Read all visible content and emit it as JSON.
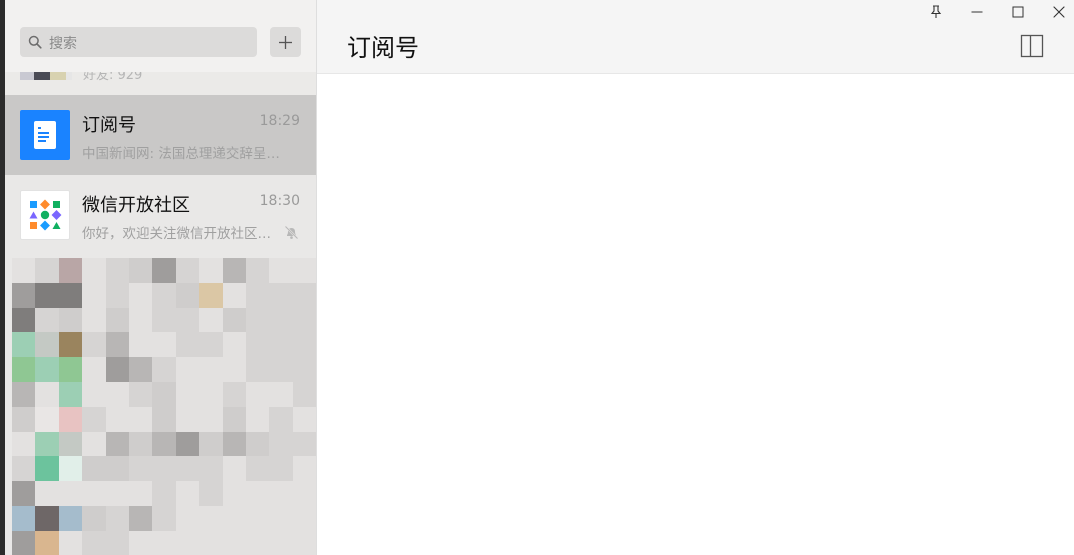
{
  "sidebar": {
    "search": {
      "placeholder": "搜索"
    },
    "partial_item": {
      "preview_fragment": "好友: 929"
    },
    "chats": [
      {
        "name": "订阅号",
        "time": "18:29",
        "preview": "中国新闻网: 法国总理递交辞呈…",
        "avatar": "subscription-icon",
        "active": true,
        "muted": false
      },
      {
        "name": "微信开放社区",
        "time": "18:30",
        "preview": "你好，欢迎关注微信开放社区…",
        "avatar": "open-community-logo",
        "active": false,
        "muted": true
      }
    ],
    "redacted_area": "pixelated-content"
  },
  "main": {
    "title": "订阅号"
  },
  "window_controls": [
    "pin-icon",
    "minimize-icon",
    "maximize-icon",
    "close-icon"
  ],
  "colors": {
    "accent": "#1a83ff",
    "sidebar_bg": "#e9e8e7",
    "active_row": "#c9c8c7",
    "header_bg": "#f5f5f5"
  }
}
